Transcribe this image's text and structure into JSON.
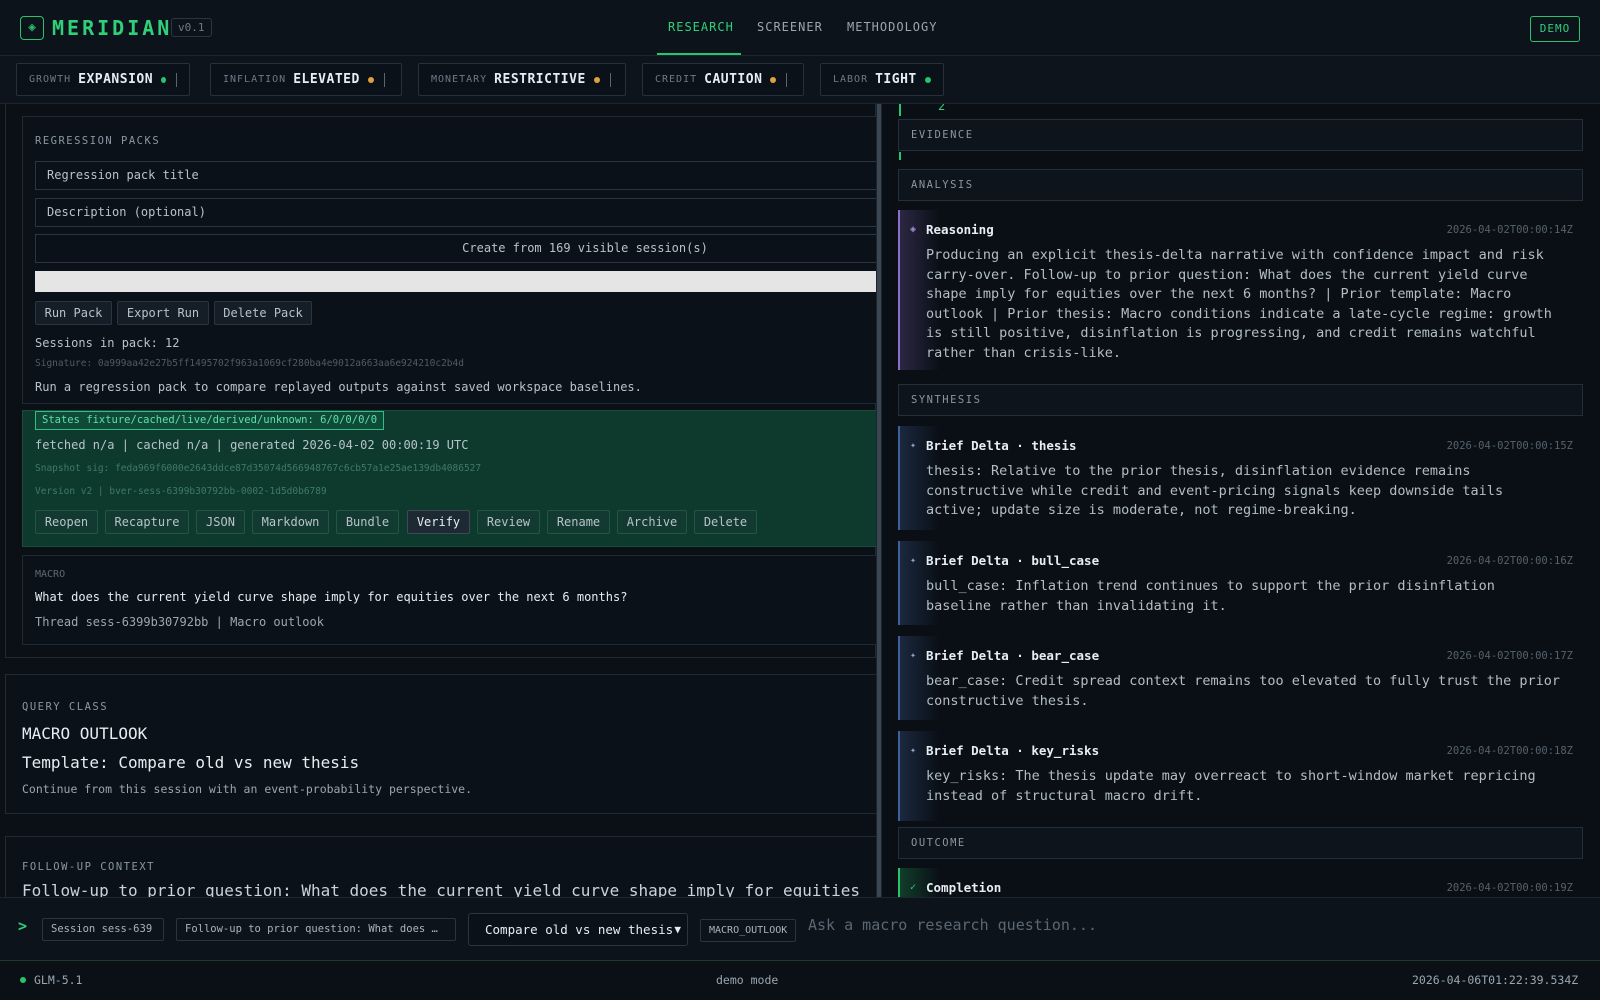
{
  "app": {
    "brand": "MERIDIAN",
    "version": "v0.1",
    "logo_icon": "◈",
    "demo_label": "DEMO"
  },
  "nav": {
    "research": "RESEARCH",
    "screener": "SCREENER",
    "methodology": "METHODOLOGY"
  },
  "regime": [
    {
      "key": "GROWTH",
      "value": "EXPANSION",
      "dot": "#27c46b"
    },
    {
      "key": "INFLATION",
      "value": "ELEVATED",
      "dot": "#e0a13a"
    },
    {
      "key": "MONETARY",
      "value": "RESTRICTIVE",
      "dot": "#e0a13a"
    },
    {
      "key": "CREDIT",
      "value": "CAUTION",
      "dot": "#e0a13a"
    },
    {
      "key": "LABOR",
      "value": "TIGHT",
      "dot": "#27c46b"
    }
  ],
  "regression": {
    "heading": "REGRESSION PACKS",
    "title_placeholder": "Regression pack title",
    "desc_placeholder": "Description (optional)",
    "create_label": "Create from 169 visible session(s)",
    "run": "Run Pack",
    "export": "Export Run",
    "delete": "Delete Pack",
    "sessions": "Sessions in pack: 12",
    "signature": "Signature: 0a999aa42e27b5ff1495702f963a1069cf280ba4e9012a663aa6e924210c2b4d",
    "hint": "Run a regression pack to compare replayed outputs against saved workspace baselines."
  },
  "session_card": {
    "states": "States fixture/cached/live/derived/unknown: 6/0/0/0/0",
    "fetched": "fetched n/a | cached n/a | generated 2026-04-02 00:00:19 UTC",
    "snapshot": "Snapshot sig: feda969f6000e2643ddce87d35074d566948767c6cb57a1e25ae139db4086527",
    "version": "Version v2 | bver-sess-6399b30792bb-0002-1d5d0b6789",
    "actions": [
      "Reopen",
      "Recapture",
      "JSON",
      "Markdown",
      "Bundle",
      "Verify",
      "Review",
      "Rename",
      "Archive",
      "Delete"
    ]
  },
  "macro_card": {
    "tag": "MACRO",
    "question": "What does the current yield curve shape imply for equities over the next 6 months?",
    "thread": "Thread sess-6399b30792bb | Macro outlook"
  },
  "query_class": {
    "heading": "QUERY CLASS",
    "cls": "MACRO OUTLOOK",
    "template": "Template: Compare old vs new thesis",
    "note": "Continue from this session with an event-probability perspective."
  },
  "followup": {
    "heading": "FOLLOW-UP CONTEXT",
    "text": "Follow-up to prior question: What does the current yield curve shape imply for equities"
  },
  "timeline": {
    "top_number": "2",
    "phases": {
      "evidence": "EVIDENCE",
      "analysis": "ANALYSIS",
      "synthesis": "SYNTHESIS",
      "outcome": "OUTCOME"
    },
    "events": [
      {
        "icon": "◈",
        "title": "Reasoning",
        "ts": "2026-04-02T00:00:14Z",
        "body": "Producing an explicit thesis-delta narrative with confidence impact and risk carry-over. Follow-up to prior question: What does the current yield curve shape imply for equities over the next 6 months? | Prior template: Macro outlook | Prior thesis: Macro conditions indicate a late-cycle regime: growth is still positive, disinflation is progressing, and credit remains watchful rather than crisis-like."
      },
      {
        "icon": "✦",
        "title": "Brief Delta · thesis",
        "ts": "2026-04-02T00:00:15Z",
        "body": "thesis: Relative to the prior thesis, disinflation evidence remains constructive while credit and event-pricing signals keep downside tails active; update size is moderate, not regime-breaking."
      },
      {
        "icon": "✦",
        "title": "Brief Delta · bull_case",
        "ts": "2026-04-02T00:00:16Z",
        "body": "bull_case: Inflation trend continues to support the prior disinflation baseline rather than invalidating it."
      },
      {
        "icon": "✦",
        "title": "Brief Delta · bear_case",
        "ts": "2026-04-02T00:00:17Z",
        "body": "bear_case: Credit spread context remains too elevated to fully trust the prior constructive thesis."
      },
      {
        "icon": "✦",
        "title": "Brief Delta · key_risks",
        "ts": "2026-04-02T00:00:18Z",
        "body": "key_risks: The thesis update may overreact to short-window market repricing instead of structural macro drift."
      },
      {
        "icon": "✓",
        "title": "Completion",
        "ts": "2026-04-02T00:00:19Z",
        "body": ""
      }
    ]
  },
  "input_bar": {
    "caret": ">",
    "session_pill": "Session sess-639",
    "followup_pill": "Follow-up to prior question: What does …",
    "template_value": "Compare old vs new thesis",
    "class_pill": "MACRO_OUTLOOK",
    "placeholder": "Ask a macro research question..."
  },
  "status": {
    "model": "GLM-5.1",
    "mode": "demo mode",
    "clock": "2026-04-06T01:22:39.534Z"
  },
  "colors": {
    "accent": "#27c46b",
    "warn": "#e0a13a",
    "reasoning": "#8d6fc9",
    "delta": "#3f5f9e"
  }
}
